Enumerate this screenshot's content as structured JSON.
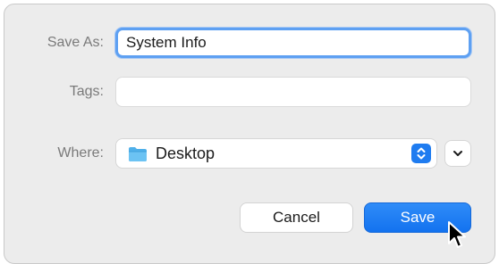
{
  "dialog": {
    "save_as_label": "Save As:",
    "save_as_value": "System Info",
    "tags_label": "Tags:",
    "tags_value": "",
    "where_label": "Where:",
    "where_value": "Desktop",
    "where_icon": "folder-icon",
    "cancel_label": "Cancel",
    "save_label": "Save"
  },
  "colors": {
    "accent": "#1F7CF0",
    "focus_ring": "#5EA0F2",
    "dialog_bg": "#ECECEC",
    "folder": "#4FB0EA"
  }
}
